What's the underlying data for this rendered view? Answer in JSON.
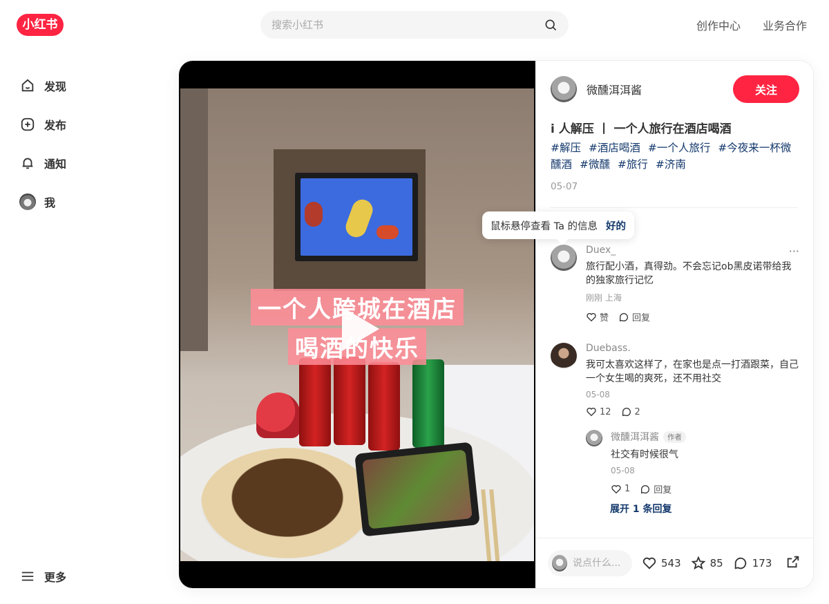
{
  "header": {
    "logo": "小红书",
    "search_placeholder": "搜索小红书",
    "links": [
      "创作中心",
      "业务合作"
    ]
  },
  "nav": {
    "items": [
      {
        "label": "发现",
        "icon": "home-icon"
      },
      {
        "label": "发布",
        "icon": "plus-square-icon"
      },
      {
        "label": "通知",
        "icon": "bell-icon"
      },
      {
        "label": "我",
        "icon": "avatar"
      }
    ],
    "more": "更多"
  },
  "video": {
    "overlay_line1": "一个人跨城在酒店",
    "overlay_line2": "喝酒的快乐"
  },
  "note": {
    "author": "微醺洱洱酱",
    "follow_label": "关注",
    "title": "i 人解压 丨 一个人旅行在酒店喝酒",
    "tags": [
      "#解压",
      "#酒店喝酒",
      "#一个人旅行",
      "#今夜来一杯微醺酒",
      "#微醺",
      "#旅行",
      "#济南"
    ],
    "date": "05-07"
  },
  "tooltip": {
    "text": "鼠标悬停查看 Ta 的信息",
    "action": "好的"
  },
  "comments": [
    {
      "name": "Duex_",
      "text": "旅行配小酒，真得劲。不会忘记ob黑皮诺带给我的独家旅行记忆",
      "meta": "刚刚 上海",
      "like": "赞",
      "reply": "回复"
    },
    {
      "name": "Duebass.",
      "text": "我可太喜欢这样了，在家也是点一打酒跟菜，自己一个女生喝的爽死，还不用社交",
      "meta": "05-08",
      "like": "12",
      "reply": "2",
      "sub_reply": {
        "name": "微醺洱洱酱",
        "badge": "作者",
        "text": "社交有时候很气",
        "meta": "05-08",
        "like": "1",
        "reply": "回复"
      },
      "expand": "展开 1 条回复"
    }
  ],
  "bottom": {
    "input_placeholder": "说点什么...",
    "likes": "543",
    "collects": "85",
    "comments": "173"
  },
  "colors": {
    "brand": "#ff2442",
    "tag": "#13386c"
  }
}
